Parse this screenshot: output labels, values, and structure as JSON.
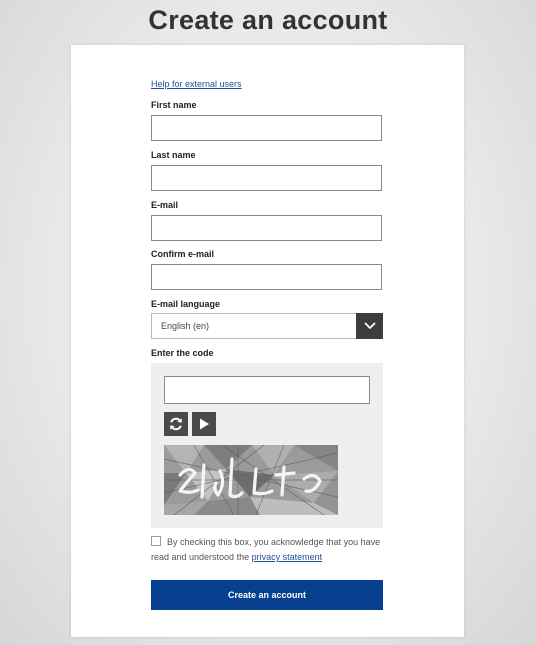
{
  "page": {
    "title": "Create an account"
  },
  "form": {
    "help_link": "Help for external users",
    "first_name": {
      "label": "First name",
      "value": ""
    },
    "last_name": {
      "label": "Last name",
      "value": ""
    },
    "email": {
      "label": "E-mail",
      "value": ""
    },
    "confirm_email": {
      "label": "Confirm e-mail",
      "value": ""
    },
    "email_language": {
      "label": "E-mail language",
      "selected": "English (en)"
    },
    "captcha": {
      "label": "Enter the code",
      "value": "",
      "refresh_icon": "refresh-icon",
      "play_icon": "play-icon"
    },
    "consent": {
      "text": "By checking this box, you acknowledge that you have read and understood the",
      "link": "privacy statement",
      "checked": false
    },
    "submit_label": "Create an account"
  },
  "colors": {
    "primary_button": "#07408e",
    "link": "#1f4e9c",
    "dropdown_arrow_bg": "#3d3d3d",
    "captcha_panel_bg": "#efefef"
  }
}
